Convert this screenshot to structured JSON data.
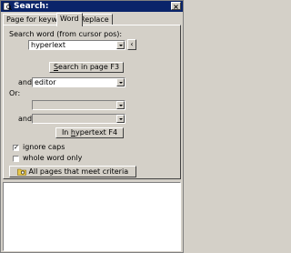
{
  "window": {
    "title": "Search:"
  },
  "tabs": [
    {
      "label": "Page for keyword",
      "active": false
    },
    {
      "label": "Word",
      "active": true
    },
    {
      "label": "Replace",
      "active": false
    }
  ],
  "form": {
    "search_label": "Search word (from cursor pos):",
    "search_value": "hyperlext",
    "lookup_button": "‹",
    "search_in_page_button": {
      "u": "S",
      "rest": "earch in page  F3"
    },
    "and1_label": "and:",
    "and1_value": "editor",
    "or_label": "Or:",
    "or_value": "",
    "and2_label": "and:",
    "and2_value": "",
    "in_hypertext_button": {
      "pre": "In ",
      "u": "h",
      "rest": "ypertext  F4"
    },
    "ignore_caps_label": "ignore caps",
    "ignore_caps_checked": true,
    "whole_word_label": "whole word only",
    "whole_word_checked": false,
    "all_pages_button": "All pages that meet criteria"
  },
  "colors": {
    "titlebar": "#0a246a",
    "face": "#d4d0c8",
    "field": "#ffffff"
  },
  "icons": [
    "app-search-icon",
    "close-icon",
    "dropdown-arrow-icon",
    "folder-search-icon",
    "checkmark-icon"
  ]
}
